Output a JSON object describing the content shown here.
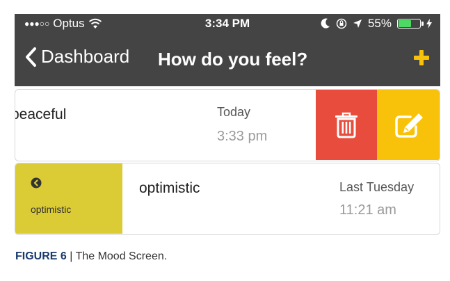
{
  "status_bar": {
    "carrier": "Optus",
    "time": "3:34 PM",
    "battery": "55%",
    "battery_level": 0.55
  },
  "nav": {
    "back_label": "Dashboard",
    "title": "How do you feel?",
    "add_icon": "plus-icon"
  },
  "moods": [
    {
      "mood": "peaceful",
      "date": "Today",
      "time": "3:33 pm",
      "actions": {
        "delete_icon": "trash-icon",
        "edit_icon": "edit-icon",
        "delete_color": "#e74c3c",
        "edit_color": "#f9c20a"
      }
    },
    {
      "mood": "optimistic",
      "tag": "optimistic",
      "date": "Last Tuesday",
      "time": "11:21 am",
      "tag_color": "#dbcb35"
    }
  ],
  "caption": {
    "figure": "FIGURE 6",
    "separator": " | ",
    "text": "The Mood Screen."
  },
  "colors": {
    "bar": "#444444",
    "accent": "#f9c20a",
    "battery": "#4cd964"
  }
}
